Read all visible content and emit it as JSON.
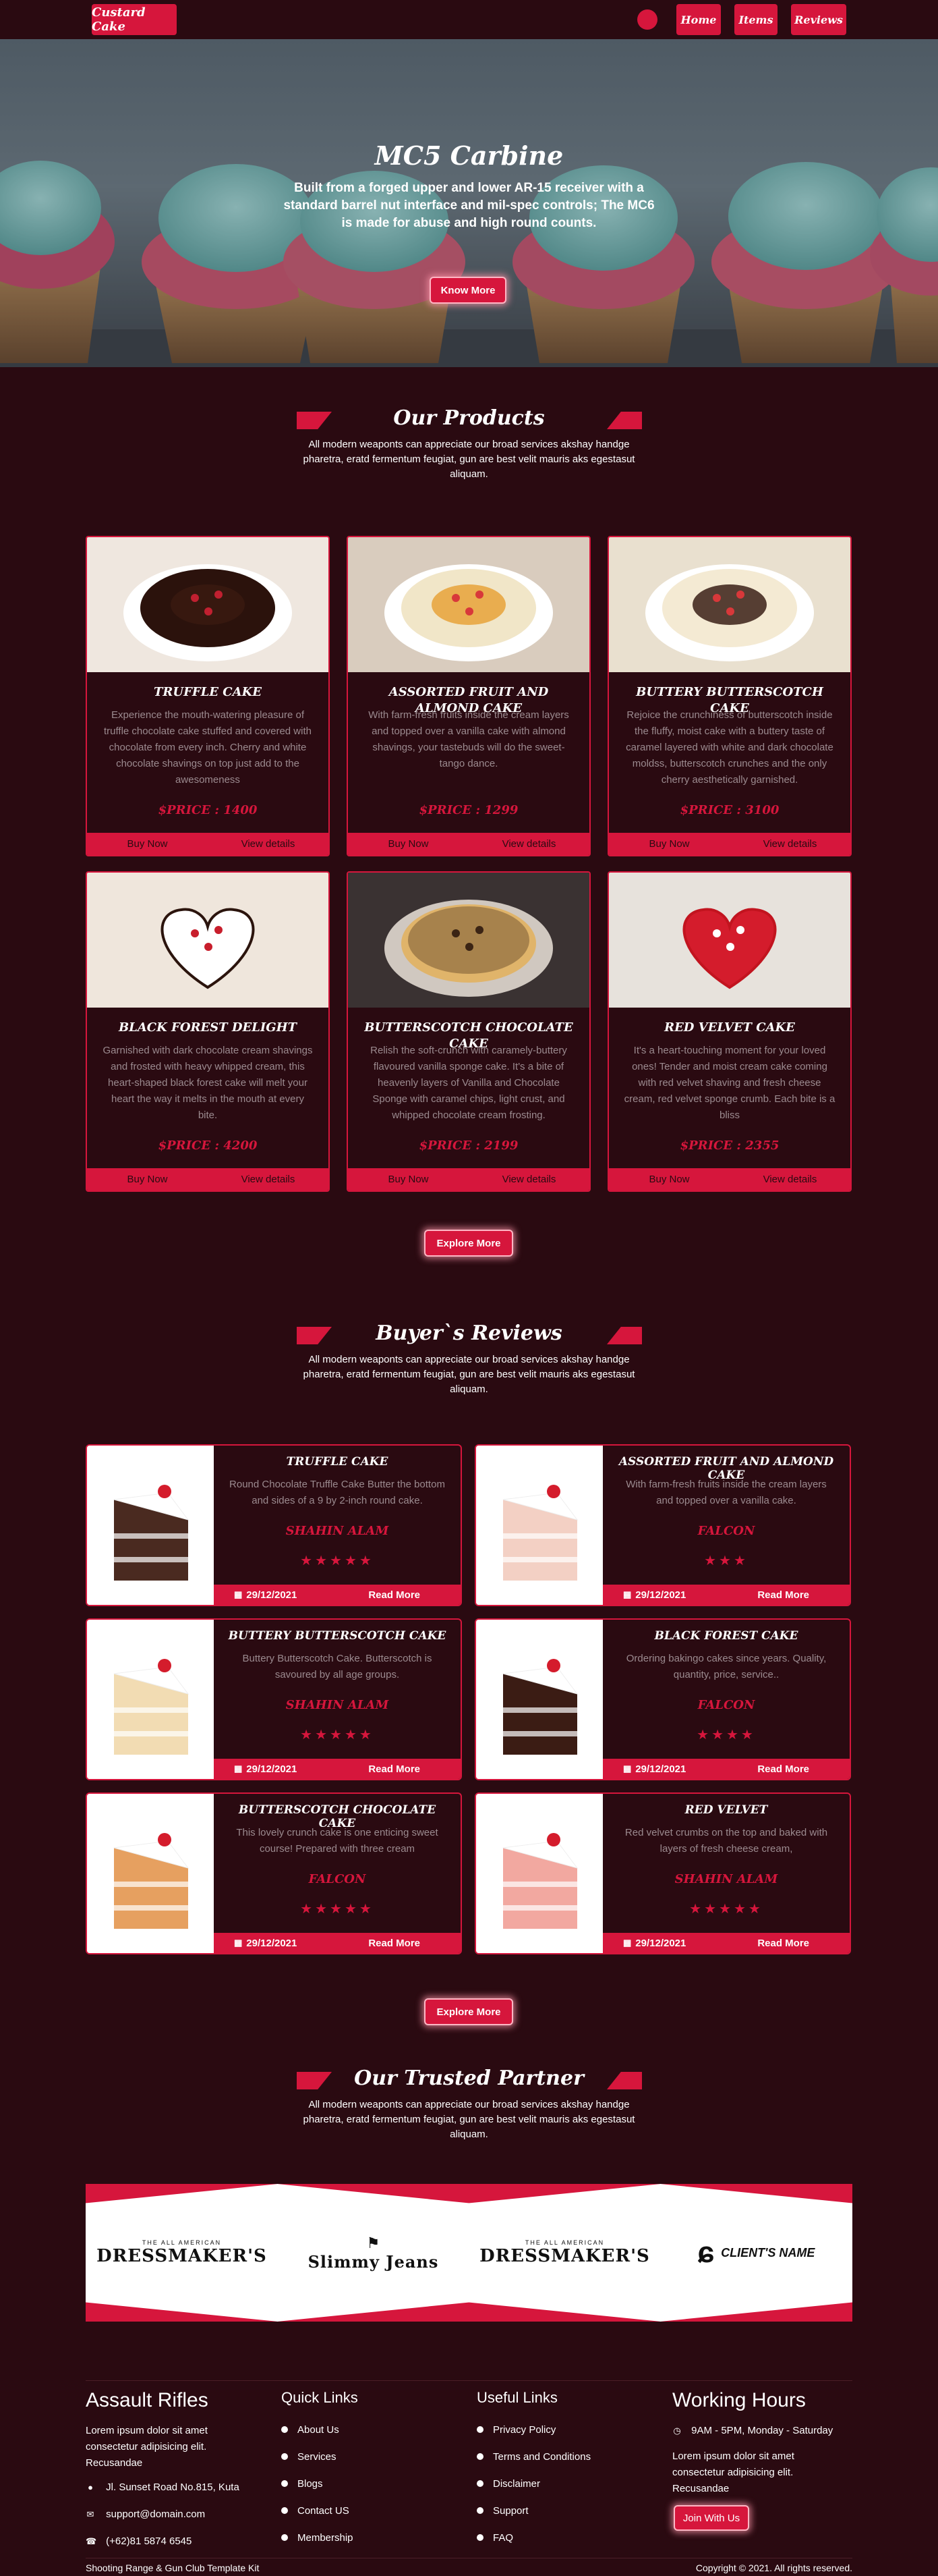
{
  "nav": {
    "logo": "Custard Cake",
    "links": [
      "Home",
      "Items",
      "Reviews"
    ]
  },
  "hero": {
    "title": "MC5 Carbine",
    "text": "Built from a forged upper and lower AR-15 receiver with a standard barrel nut interface and mil-spec controls; The MC6 is made for abuse and high round counts.",
    "button": "Know More"
  },
  "products": {
    "title": "Our Products",
    "subtitle": "All modern weaponts can appreciate our broad services akshay handge pharetra, eratd fermentum feugiat, gun are best velit mauris aks egestasut aliquam.",
    "items": [
      {
        "name": "TRUFFLE CAKE",
        "desc": "Experience the mouth-watering pleasure of truffle chocolate cake stuffed and covered with chocolate from every inch. Cherry and white chocolate shavings on top just add to the awesomeness",
        "price": "$PRICE : 1400"
      },
      {
        "name": "ASSORTED FRUIT AND ALMOND CAKE",
        "desc": "With farm-fresh fruits inside the cream layers and topped over a vanilla cake with almond shavings, your tastebuds will do the sweet-tango dance.",
        "price": "$PRICE : 1299"
      },
      {
        "name": "BUTTERY BUTTERSCOTCH CAKE",
        "desc": "Rejoice the crunchiness of butterscotch inside the fluffy, moist cake with a buttery taste of caramel layered with white and dark chocolate moldss, butterscotch crunches and the only cherry aesthetically garnished.",
        "price": "$PRICE : 3100"
      },
      {
        "name": "BLACK FOREST DELIGHT",
        "desc": "Garnished with dark chocolate cream shavings and frosted with heavy whipped cream, this heart-shaped black forest cake will melt your heart the way it melts in the mouth at every bite.",
        "price": "$PRICE : 4200"
      },
      {
        "name": "BUTTERSCOTCH CHOCOLATE CAKE",
        "desc": "Relish the soft-crunch with caramely-buttery flavoured vanilla sponge cake. It's a bite of heavenly layers of Vanilla and Chocolate Sponge with caramel chips, light crust, and whipped chocolate cream frosting.",
        "price": "$PRICE : 2199"
      },
      {
        "name": "RED VELVET CAKE",
        "desc": "It's a heart-touching moment for your loved ones! Tender and moist cream cake coming with red velvet shaving and fresh cheese cream, red velvet sponge crumb. Each bite is a bliss",
        "price": "$PRICE : 2355"
      }
    ],
    "buy_label": "Buy Now",
    "details_label": "View details",
    "explore": "Explore More"
  },
  "reviews": {
    "title": "Buyer`s Reviews",
    "subtitle": "All modern weaponts can appreciate our broad services akshay handge pharetra, eratd fermentum feugiat, gun are best velit mauris aks egestasut aliquam.",
    "items": [
      {
        "name": "TRUFFLE CAKE",
        "desc": "Round Chocolate Truffle Cake Butter the bottom and sides of a 9 by 2-inch round cake.",
        "author": "SHAHIN ALAM",
        "stars": "★★★★★",
        "date": "29/12/2021"
      },
      {
        "name": "ASSORTED FRUIT AND ALMOND CAKE",
        "desc": "With farm-fresh fruits inside the cream layers and topped over a vanilla cake.",
        "author": "FALCON",
        "stars": "★★★",
        "date": "29/12/2021"
      },
      {
        "name": "BUTTERY BUTTERSCOTCH CAKE",
        "desc": "Buttery Butterscotch Cake. Butterscotch is savoured by all age groups.",
        "author": "SHAHIN ALAM",
        "stars": "★★★★★",
        "date": "29/12/2021"
      },
      {
        "name": "BLACK FOREST CAKE",
        "desc": "Ordering bakingo cakes since years. Quality, quantity, price, service..",
        "author": "FALCON",
        "stars": "★★★★",
        "date": "29/12/2021"
      },
      {
        "name": "BUTTERSCOTCH CHOCOLATE CAKE",
        "desc": "This lovely crunch cake is one enticing sweet course! Prepared with three cream",
        "author": "FALCON",
        "stars": "★★★★★",
        "date": "29/12/2021"
      },
      {
        "name": "RED VELVET",
        "desc": "Red velvet crumbs on the top and baked with layers of fresh cheese cream,",
        "author": "SHAHIN ALAM",
        "stars": "★★★★★",
        "date": "29/12/2021"
      }
    ],
    "read_more": "Read More",
    "explore": "Explore More"
  },
  "partners": {
    "title": "Our Trusted Partner",
    "subtitle": "All modern weaponts can appreciate our broad services akshay handge pharetra, eratd fermentum feugiat, gun are best velit mauris aks egestasut aliquam.",
    "logos": [
      {
        "small": "THE ALL AMERICAN",
        "name": "DRESSMAKER'S"
      },
      {
        "small": "",
        "name": "Slimmy Jeans"
      },
      {
        "small": "THE ALL AMERICAN",
        "name": "DRESSMAKER'S"
      },
      {
        "small": "",
        "name": "CLIENT'S NAME"
      }
    ]
  },
  "footer": {
    "about": {
      "title": "Assault Rifles",
      "text": "Lorem ipsum dolor sit amet consectetur adipisicing elit. Recusandae",
      "address": "Jl. Sunset Road No.815, Kuta",
      "email": "support@domain.com",
      "phone": "(+62)81 5874 6545"
    },
    "quick_links": {
      "title": "Quick Links",
      "items": [
        "About Us",
        "Services",
        "Blogs",
        "Contact US",
        "Membership"
      ]
    },
    "useful_links": {
      "title": "Useful Links",
      "items": [
        "Privacy Policy",
        "Terms and Conditions",
        "Disclaimer",
        "Support",
        "FAQ"
      ]
    },
    "hours": {
      "title": "Working Hours",
      "time": "9AM - 5PM, Monday - Saturday",
      "text": "Lorem ipsum dolor sit amet consectetur adipisicing elit. Recusandae",
      "button": "Join With Us"
    },
    "bottom_left": "Shooting Range & Gun Club Template Kit",
    "bottom_right": "Copyright © 2021. All rights reserved."
  },
  "colors": {
    "accent": "#d6163c",
    "background": "#2a0a11"
  }
}
